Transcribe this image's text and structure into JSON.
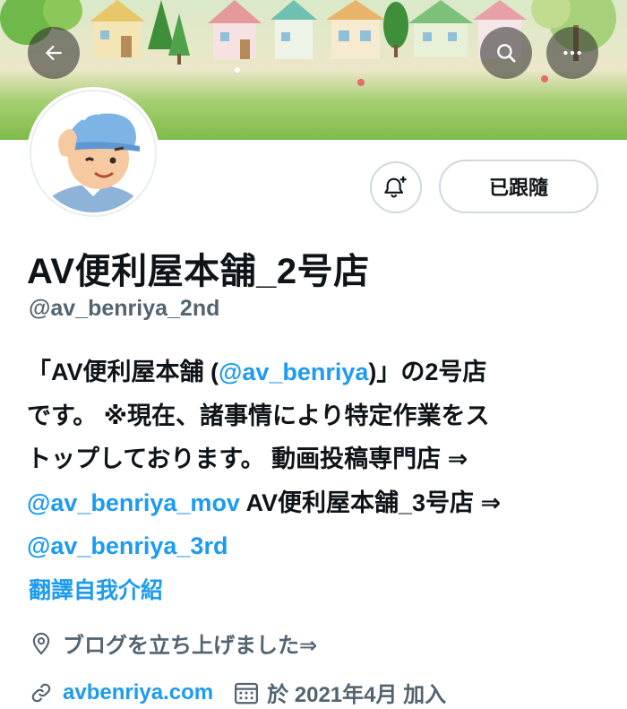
{
  "header": {
    "back_icon": "arrow-left-icon",
    "search_icon": "search-icon",
    "more_icon": "more-horizontal-icon"
  },
  "profile": {
    "display_name": "AV便利屋本舗_2号店",
    "handle": "@av_benriya_2nd",
    "follow_button_label": "已跟隨",
    "notify_icon": "bell-plus-icon"
  },
  "bio": {
    "line1_pre": "「AV便利屋本舗 (",
    "line1_link": "@av_benriya",
    "line1_post": ")」の2号店",
    "line2": "です。 ※現在、諸事情により特定作業をス",
    "line3": "トップしております。 動画投稿専門店 ⇒",
    "line4_link": "@av_benriya_mov",
    "line4_post": " AV便利屋本舗_3号店 ⇒",
    "line5_link": "@av_benriya_3rd"
  },
  "translate_label": "翻譯自我介紹",
  "location": {
    "icon": "location-pin-icon",
    "text": "ブログを立ち上げました⇒"
  },
  "website": {
    "icon": "link-icon",
    "text": "avbenriya.com"
  },
  "joined": {
    "icon": "calendar-icon",
    "text": "於 2021年4月 加入"
  },
  "colors": {
    "accent": "#1d9bf0",
    "secondary_text": "#536471",
    "primary_text": "#0f1419",
    "border": "#cfd9de"
  }
}
